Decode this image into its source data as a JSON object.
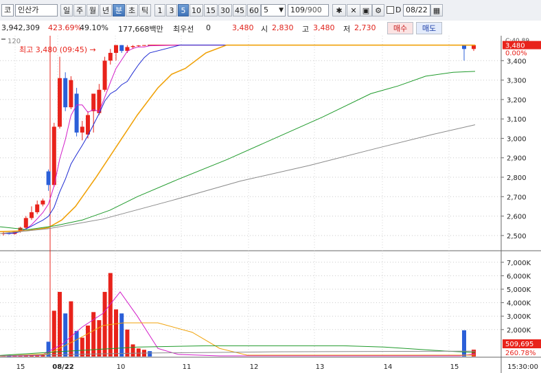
{
  "toolbar": {
    "market_code": "코",
    "stock_name": "인산가",
    "period_tabs": [
      "일",
      "주",
      "월",
      "년",
      "분",
      "초",
      "틱"
    ],
    "active_period": "분",
    "interval_tabs": [
      "1",
      "3",
      "5",
      "10",
      "15",
      "30",
      "45",
      "60"
    ],
    "active_interval": "5",
    "interval_select": "5",
    "count_current": "109",
    "count_total": "/900",
    "d_checkbox_label": "D",
    "date_value": "08/22"
  },
  "infobar": {
    "volume": "3,942,309",
    "change_rate": "423.69%",
    "turnover": "49.10%",
    "amount": "177,668백만",
    "priority_label": "최우선",
    "priority_value": "0",
    "current_price": "3,480",
    "open_label": "시",
    "open_value": "2,830",
    "high_label": "고",
    "high_value": "3,480",
    "low_label": "저",
    "low_value": "2,730",
    "buy_button": "매수",
    "sell_button": "매도"
  },
  "chart": {
    "ma_label": "120",
    "high_annotation": "최고 3,480 (09:45) →",
    "price_axis_ticks": [
      "3,400",
      "3,300",
      "3,200",
      "3,100",
      "3,000",
      "2,900",
      "2,800",
      "2,700",
      "2,600",
      "2,500"
    ],
    "price_axis_top": "C:40.89",
    "current_price_tag": "3,480",
    "current_pct_tag": "0.00%",
    "volume_axis_ticks": [
      "7,000K",
      "6,000K",
      "5,000K",
      "4,000K",
      "3,000K",
      "2,000K"
    ],
    "volume_tag": "509,695",
    "volume_pct_tag": "260.78%",
    "time_labels": [
      "15",
      "08/22",
      "10",
      "11",
      "12",
      "13",
      "14",
      "15"
    ],
    "time_end": "15:30:00",
    "colors": {
      "up": "#e8231b",
      "down": "#2b5fd8",
      "ma5": "#d21cc8",
      "ma10": "#1e2ad2",
      "ma20": "#f0a20a",
      "ma60": "#1e9a2a",
      "ma120": "#8a8a8a",
      "vline": "#e8231b"
    }
  },
  "chart_data": {
    "type": "candlestick",
    "candles": [
      {
        "o": 2510,
        "h": 2520,
        "l": 2500,
        "c": 2512
      },
      {
        "o": 2512,
        "h": 2518,
        "l": 2505,
        "c": 2508
      },
      {
        "o": 2508,
        "h": 2522,
        "l": 2505,
        "c": 2520
      },
      {
        "o": 2520,
        "h": 2545,
        "l": 2515,
        "c": 2540
      },
      {
        "o": 2540,
        "h": 2600,
        "l": 2535,
        "c": 2590
      },
      {
        "o": 2590,
        "h": 2650,
        "l": 2580,
        "c": 2620
      },
      {
        "o": 2620,
        "h": 2680,
        "l": 2610,
        "c": 2660
      },
      {
        "o": 2660,
        "h": 2690,
        "l": 2650,
        "c": 2680
      },
      {
        "o": 2830,
        "h": 2840,
        "l": 2730,
        "c": 2760
      },
      {
        "o": 2760,
        "h": 3080,
        "l": 2750,
        "c": 3060
      },
      {
        "o": 3060,
        "h": 3420,
        "l": 3050,
        "c": 3310
      },
      {
        "o": 3310,
        "h": 3340,
        "l": 3140,
        "c": 3160
      },
      {
        "o": 3160,
        "h": 3320,
        "l": 3150,
        "c": 3300
      },
      {
        "o": 3230,
        "h": 3260,
        "l": 3010,
        "c": 3030
      },
      {
        "o": 3030,
        "h": 3090,
        "l": 2990,
        "c": 3060
      },
      {
        "o": 3020,
        "h": 3140,
        "l": 3000,
        "c": 3120
      },
      {
        "o": 3140,
        "h": 3180,
        "l": 3030,
        "c": 3230
      },
      {
        "o": 3130,
        "h": 3280,
        "l": 3120,
        "c": 3250
      },
      {
        "o": 3250,
        "h": 3420,
        "l": 3240,
        "c": 3400
      },
      {
        "o": 3400,
        "h": 3460,
        "l": 3380,
        "c": 3440
      },
      {
        "o": 3440,
        "h": 3480,
        "l": 3400,
        "c": 3480
      },
      {
        "o": 3480,
        "h": 3480,
        "l": 3440,
        "c": 3450
      },
      {
        "o": 3450,
        "h": 3480,
        "l": 3440,
        "c": 3470
      },
      {
        "o": 3470,
        "h": 3480,
        "l": 3460,
        "c": 3475
      },
      {
        "o": 3475,
        "h": 3480,
        "l": 3470,
        "c": 3478
      },
      {
        "o": 3478,
        "h": 3480,
        "l": 3475,
        "c": 3480
      },
      {
        "o": 3480,
        "h": 3480,
        "l": 3478,
        "c": 3479
      }
    ],
    "volumes_k": [
      60,
      40,
      50,
      60,
      80,
      100,
      120,
      140,
      1100,
      3400,
      4800,
      3200,
      4100,
      1900,
      1400,
      2300,
      3300,
      2700,
      4800,
      6200,
      3500,
      3200,
      2000,
      900,
      600,
      500,
      400
    ],
    "late_candles": [
      {
        "o": 3480,
        "h": 3480,
        "l": 3400,
        "c": 3460
      },
      {
        "o": 3460,
        "h": 3480,
        "l": 3450,
        "c": 3480
      }
    ],
    "late_volumes_k": [
      1950,
      510
    ],
    "ylim": [
      2450,
      3500
    ],
    "vol_ylim": [
      0,
      7500
    ]
  }
}
